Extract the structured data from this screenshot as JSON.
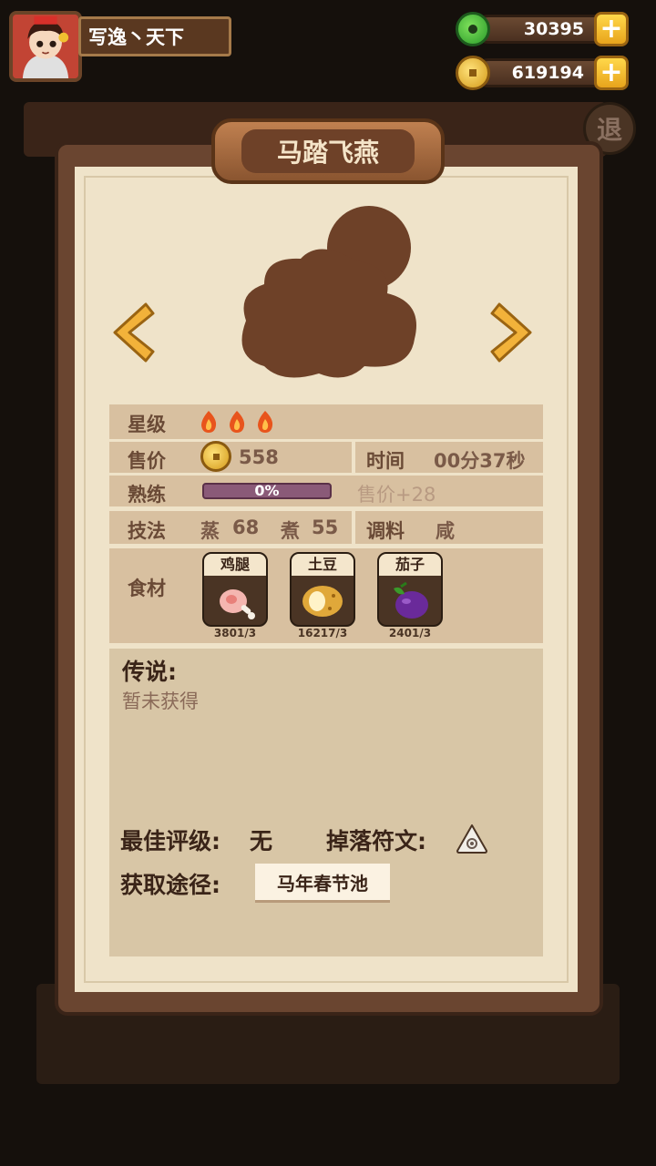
{
  "player": {
    "name": "写逸丶天下"
  },
  "resources": {
    "jade": "30395",
    "coins": "619194"
  },
  "exit_label": "退",
  "dish": {
    "title": "马踏飞燕",
    "stars_label": "星级",
    "stars": 3,
    "price_label": "售价",
    "price": "558",
    "time_label": "时间",
    "time": "00分37秒",
    "mastery_label": "熟练",
    "mastery": "0%",
    "mastery_bonus": "售价+28",
    "technique_label": "技法",
    "technique_steam": "蒸",
    "steam_value": "68",
    "technique_boil": "煮",
    "boil_value": "55",
    "seasoning_label": "调料",
    "seasoning": "咸",
    "ingredients_label": "食材",
    "ingredients": [
      {
        "name": "鸡腿",
        "count": "3801/3"
      },
      {
        "name": "土豆",
        "count": "16217/3"
      },
      {
        "name": "茄子",
        "count": "2401/3"
      }
    ]
  },
  "legend": {
    "title": "传说:",
    "text": "暂未获得"
  },
  "best_rating_label": "最佳评级:",
  "best_rating": "无",
  "rune_drop_label": "掉落符文:",
  "obtain_label": "获取途径:",
  "obtain_source": "马年春节池",
  "colors": {
    "parchment": "#efe3c9",
    "row_bg": "#d8c0a0",
    "label_brown": "#6a4a36",
    "accent_gold": "#e8a41c"
  }
}
